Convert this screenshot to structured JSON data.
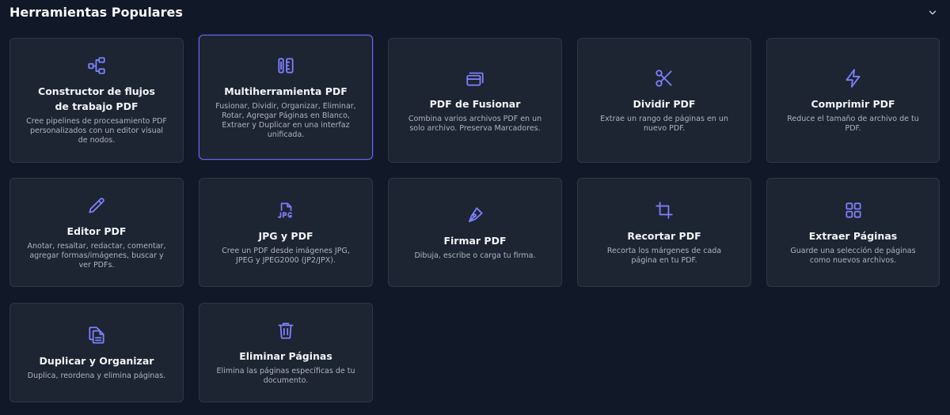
{
  "section": {
    "title": "Herramientas Populares"
  },
  "colors": {
    "background": "#111827",
    "card": "#1d2432",
    "card_border": "#2f3746",
    "accent": "#6366f1",
    "icon": "#7c7ff7"
  },
  "tools": [
    {
      "title": "Constructor de flujos de trabajo PDF",
      "description": "Cree pipelines de procesamiento PDF personalizados con un editor visual de nodos.",
      "icon": "workflow-icon"
    },
    {
      "title": "Multiherramienta PDF",
      "description": "Fusionar, Dividir, Organizar, Eliminar, Rotar, Agregar Páginas en Blanco, Extraer y Duplicar en una interfaz unificada.",
      "icon": "tools-icon"
    },
    {
      "title": "PDF de Fusionar",
      "description": "Combina varios archivos PDF en un solo archivo. Preserva Marcadores.",
      "icon": "merge-stack-icon"
    },
    {
      "title": "Dividir PDF",
      "description": "Extrae un rango de páginas en un nuevo PDF.",
      "icon": "scissors-icon"
    },
    {
      "title": "Comprimir PDF",
      "description": "Reduce el tamaño de archivo de tu PDF.",
      "icon": "lightning-icon"
    },
    {
      "title": "Editor PDF",
      "description": "Anotar, resaltar, redactar, comentar, agregar formas/imágenes, buscar y ver PDFs.",
      "icon": "pencil-icon"
    },
    {
      "title": "JPG y PDF",
      "description": "Cree un PDF desde imágenes JPG, JPEG y JPEG2000 (JP2/JPX).",
      "icon": "jpg-file-icon"
    },
    {
      "title": "Firmar PDF",
      "description": "Dibuja, escribe o carga tu firma.",
      "icon": "pen-nib-icon"
    },
    {
      "title": "Recortar PDF",
      "description": "Recorta los márgenes de cada página en tu PDF.",
      "icon": "crop-icon"
    },
    {
      "title": "Extraer Páginas",
      "description": "Guarde una selección de páginas como nuevos archivos.",
      "icon": "grid-icon"
    },
    {
      "title": "Duplicar y Organizar",
      "description": "Duplica, reordena y elimina páginas.",
      "icon": "copy-file-icon"
    },
    {
      "title": "Eliminar Páginas",
      "description": "Elimina las páginas específicas de tu documento.",
      "icon": "trash-icon"
    }
  ]
}
